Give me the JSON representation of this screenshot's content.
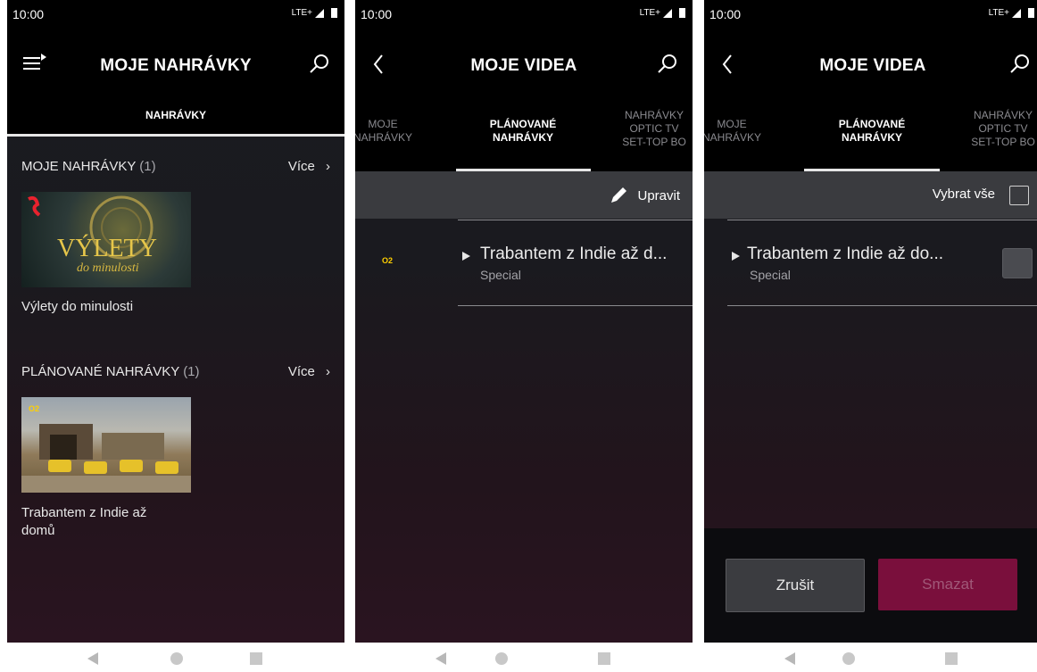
{
  "status": {
    "time": "10:00",
    "network": "LTE+"
  },
  "screen1": {
    "title": "MOJE NAHRÁVKY",
    "tab_label": "NAHRÁVKY",
    "section1": {
      "label": "MOJE NAHRÁVKY",
      "count": "(1)",
      "more": "Více",
      "card_title": "Výlety do minulosti",
      "thumb_logo_main": "VÝLETY",
      "thumb_logo_sub": "do minulosti"
    },
    "section2": {
      "label": "PLÁNOVANÉ NAHRÁVKY",
      "count": "(1)",
      "more": "Více",
      "card_title_line1": "Trabantem z Indie až",
      "card_title_line2": "domů",
      "thumb_channel": "O2"
    }
  },
  "screen2": {
    "title": "MOJE VIDEA",
    "tabs": [
      {
        "line1": "MOJE",
        "line2": "NAHRÁVKY"
      },
      {
        "line1": "PLÁNOVANÉ",
        "line2": "NAHRÁVKY"
      },
      {
        "line1": "NAHRÁVKY",
        "line2": "OPTIC TV",
        "line3": "SET-TOP BO"
      }
    ],
    "edit_label": "Upravit",
    "channel_logo": "O2",
    "recording": {
      "title": "Trabantem z Indie až d...",
      "subtitle": "Special"
    }
  },
  "screen3": {
    "title": "MOJE VIDEA",
    "tabs": [
      {
        "line1": "MOJE",
        "line2": "NAHRÁVKY"
      },
      {
        "line1": "PLÁNOVANÉ",
        "line2": "NAHRÁVKY"
      },
      {
        "line1": "NAHRÁVKY",
        "line2": "OPTIC TV",
        "line3": "SET-TOP BO"
      }
    ],
    "select_all_label": "Vybrat vše",
    "recording": {
      "title": "Trabantem z Indie až do...",
      "subtitle": "Special"
    },
    "cancel_label": "Zrušit",
    "delete_label": "Smazat"
  },
  "colors": {
    "accent": "#7a0f3c",
    "background": "#1b1c20"
  }
}
